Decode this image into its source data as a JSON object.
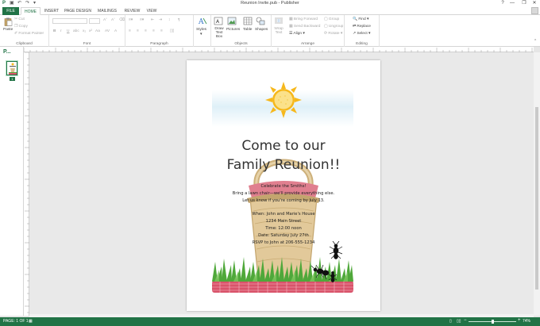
{
  "window": {
    "title": "Reunion Invite.pub - Publisher",
    "controls": [
      "?",
      "—",
      "❐",
      "✕"
    ]
  },
  "quick_access": {
    "app_icon": "publisher-logo",
    "save": "save-icon",
    "undo": "undo-icon",
    "redo": "redo-icon"
  },
  "tabs": [
    "FILE",
    "HOME",
    "INSERT",
    "PAGE DESIGN",
    "MAILINGS",
    "REVIEW",
    "VIEW"
  ],
  "active_tab": "HOME",
  "ribbon": {
    "clipboard": {
      "label": "Clipboard",
      "paste": "Paste",
      "cut": "Cut",
      "copy": "Copy",
      "format_painter": "Format Painter"
    },
    "font": {
      "label": "Font",
      "bold": "B",
      "italic": "I",
      "underline": "U"
    },
    "paragraph": {
      "label": "Paragraph"
    },
    "styles": {
      "label": "Styles"
    },
    "objects": {
      "label": "Objects",
      "draw_text_box": "Draw Text Box",
      "pictures": "Pictures",
      "table": "Table",
      "shapes": "Shapes"
    },
    "arrange": {
      "label": "Arrange",
      "wrap_text": "Wrap Text",
      "bring_forward": "Bring Forward",
      "send_backward": "Send Backward",
      "align": "Align",
      "group": "Group",
      "ungroup": "Ungroup",
      "rotate": "Rotate"
    },
    "editing": {
      "label": "Editing",
      "find": "Find",
      "replace": "Replace",
      "select": "Select"
    }
  },
  "pages_pane": {
    "label": "P...",
    "page_number": "1"
  },
  "flyer": {
    "title_line1": "Come to our",
    "title_line2": "Family Reunion!!",
    "body": [
      "Celebrate the Smiths!",
      "Bring a lawn chair—we'll provide everything else.",
      "Let us know if you're coming by July 13."
    ],
    "details": [
      "When: John and Marie's House",
      "1234 Main Street",
      "Time: 12:00 noon",
      "Date: Saturday July 27th",
      "RSVP to  John at 206-555-1234"
    ]
  },
  "status": {
    "page": "PAGE: 1 OF 1",
    "zoom": "74%"
  },
  "colors": {
    "accent": "#217346",
    "sky": "#dff0f8",
    "grass": "#4fa83a",
    "tablecloth": "#d9536a",
    "basket": "#d9bf8f",
    "sun": "#f6b81c"
  }
}
